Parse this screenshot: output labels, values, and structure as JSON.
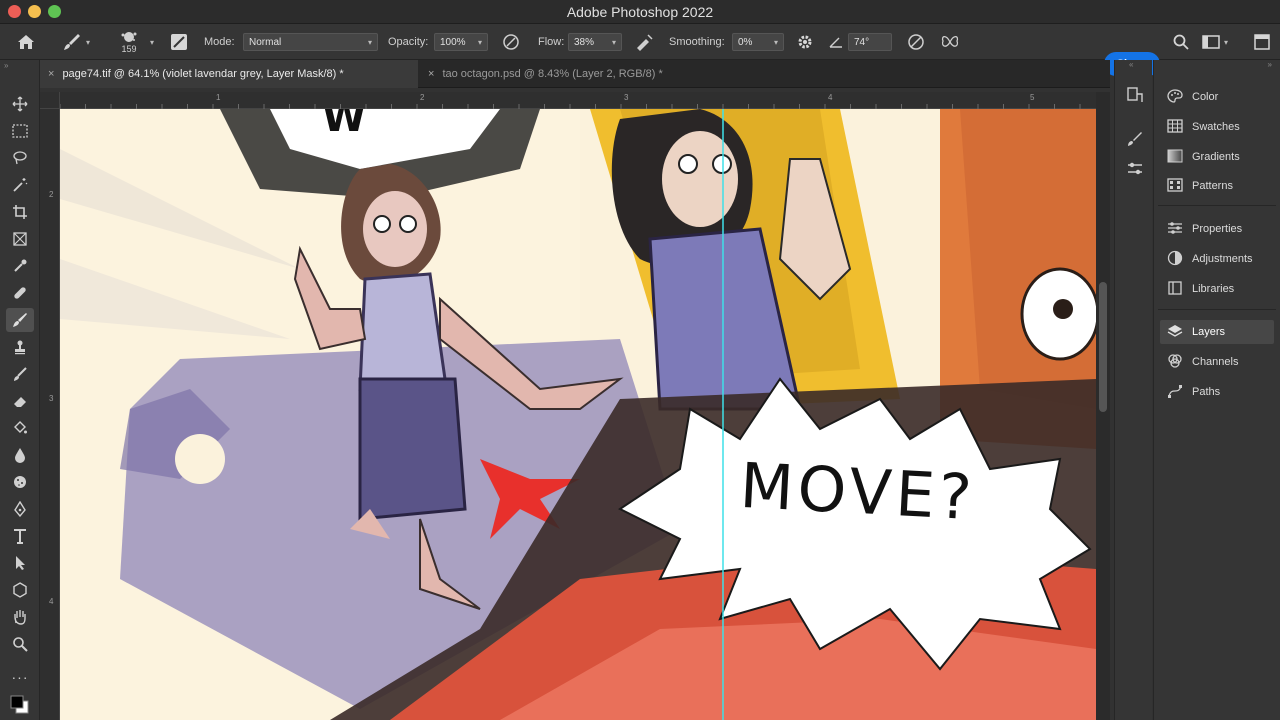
{
  "app": {
    "title": "Adobe Photoshop 2022"
  },
  "options": {
    "brush_size": "159",
    "mode_label": "Mode:",
    "mode_value": "Normal",
    "opacity_label": "Opacity:",
    "opacity_value": "100%",
    "flow_label": "Flow:",
    "flow_value": "38%",
    "smoothing_label": "Smoothing:",
    "smoothing_value": "0%",
    "angle_value": "74°",
    "share_label": "Share"
  },
  "tabs": [
    {
      "label": "page74.tif @ 64.1% (violet lavendar grey, Layer Mask/8) *"
    },
    {
      "label": "tao octagon.psd @ 8.43% (Layer 2, RGB/8) *"
    }
  ],
  "ruler": {
    "h": [
      "1",
      "2",
      "3",
      "4",
      "5"
    ],
    "v": [
      "2",
      "3",
      "4"
    ]
  },
  "canvas": {
    "speech_text": "MOVE?",
    "top_text": "W"
  },
  "panels": {
    "group1": [
      {
        "label": "Color",
        "icon": "color-icon"
      },
      {
        "label": "Swatches",
        "icon": "swatches-icon"
      },
      {
        "label": "Gradients",
        "icon": "gradients-icon"
      },
      {
        "label": "Patterns",
        "icon": "patterns-icon"
      }
    ],
    "group2": [
      {
        "label": "Properties",
        "icon": "properties-icon"
      },
      {
        "label": "Adjustments",
        "icon": "adjustments-icon"
      },
      {
        "label": "Libraries",
        "icon": "libraries-icon"
      }
    ],
    "group3": [
      {
        "label": "Layers",
        "icon": "layers-icon"
      },
      {
        "label": "Channels",
        "icon": "channels-icon"
      },
      {
        "label": "Paths",
        "icon": "paths-icon"
      }
    ]
  },
  "colors": {
    "accent": "#1473e6",
    "guide": "#3ee0e8"
  }
}
